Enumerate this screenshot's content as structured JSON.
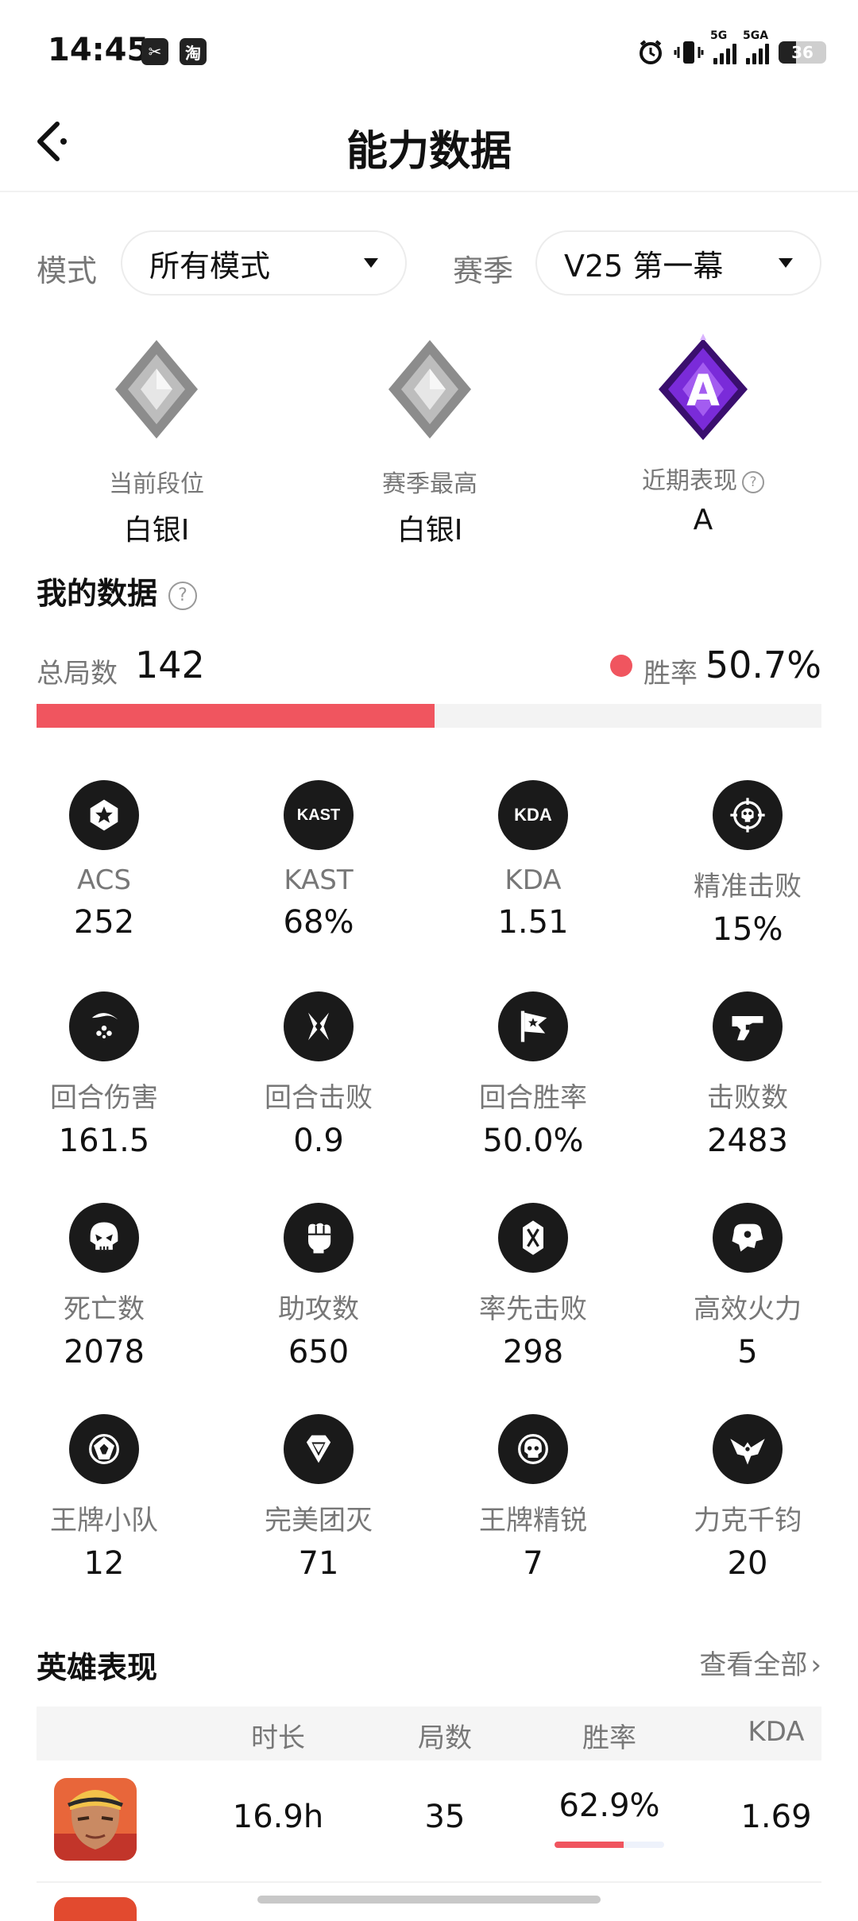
{
  "status_bar": {
    "time": "14:45",
    "app1": "✂",
    "app2": "淘",
    "net1": "5G",
    "net2": "5GA",
    "battery": "36"
  },
  "header": {
    "title": "能力数据"
  },
  "filters": {
    "mode_label": "模式",
    "mode_value": "所有模式",
    "season_label": "赛季",
    "season_value": "V25 第一幕"
  },
  "ranks": [
    {
      "label": "当前段位",
      "value": "白银I"
    },
    {
      "label": "赛季最高",
      "value": "白银I"
    },
    {
      "label": "近期表现",
      "value": "A",
      "emblem_letter": "A"
    }
  ],
  "my_data": {
    "title": "我的数据",
    "total_label": "总局数",
    "total_value": "142",
    "win_label": "胜率",
    "win_value": "50.7%",
    "win_rate": 0.507
  },
  "stats": [
    {
      "label": "ACS",
      "value": "252",
      "icon": "star-badge-icon"
    },
    {
      "label": "KAST",
      "value": "68%",
      "icon": "kast-icon",
      "icon_text": "KAST"
    },
    {
      "label": "KDA",
      "value": "1.51",
      "icon": "kda-icon",
      "icon_text": "KDA"
    },
    {
      "label": "精准击败",
      "value": "15%",
      "icon": "crosshair-skull-icon"
    },
    {
      "label": "回合伤害",
      "value": "161.5",
      "icon": "damage-icon"
    },
    {
      "label": "回合击败",
      "value": "0.9",
      "icon": "crossed-blades-icon"
    },
    {
      "label": "回合胜率",
      "value": "50.0%",
      "icon": "flag-star-icon"
    },
    {
      "label": "击败数",
      "value": "2483",
      "icon": "gun-icon"
    },
    {
      "label": "死亡数",
      "value": "2078",
      "icon": "skull-icon"
    },
    {
      "label": "助攻数",
      "value": "650",
      "icon": "fist-icon"
    },
    {
      "label": "率先击败",
      "value": "298",
      "icon": "first-blood-icon"
    },
    {
      "label": "高效火力",
      "value": "5",
      "icon": "firepower-icon"
    },
    {
      "label": "王牌小队",
      "value": "12",
      "icon": "ace-squad-icon"
    },
    {
      "label": "完美团灭",
      "value": "71",
      "icon": "diamond-icon"
    },
    {
      "label": "王牌精锐",
      "value": "7",
      "icon": "ace-skull-icon"
    },
    {
      "label": "力克千钧",
      "value": "20",
      "icon": "eagle-icon"
    }
  ],
  "heroes": {
    "title": "英雄表现",
    "view_all": "查看全部",
    "columns": [
      "时长",
      "局数",
      "胜率",
      "KDA"
    ],
    "rows": [
      {
        "time": "16.9h",
        "games": "35",
        "win_rate": "62.9%",
        "win_fraction": 0.629,
        "kda": "1.69"
      }
    ]
  },
  "colors": {
    "accent": "#f0555f",
    "icon_bg": "#1a1a1a",
    "silver": "#9a9a9a",
    "purple": "#7a2bd9"
  }
}
